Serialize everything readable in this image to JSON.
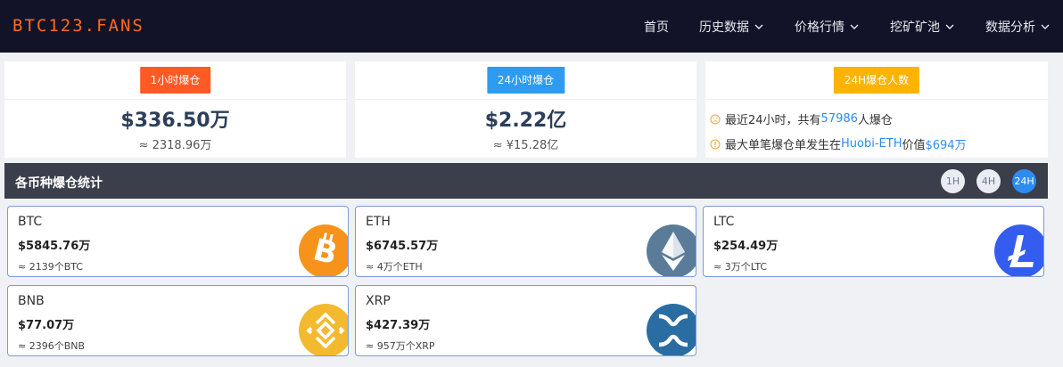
{
  "header": {
    "logo": "BTC123.FANS",
    "nav": [
      {
        "label": "首页",
        "dropdown": false
      },
      {
        "label": "历史数据",
        "dropdown": true
      },
      {
        "label": "价格行情",
        "dropdown": true
      },
      {
        "label": "挖矿矿池",
        "dropdown": true
      },
      {
        "label": "数据分析",
        "dropdown": true
      }
    ]
  },
  "summary": {
    "hour1": {
      "badge": "1小时爆仓",
      "badge_color": "#ff5a23",
      "value": "$336.50万",
      "sub": "≈ 2318.96万"
    },
    "hour24": {
      "badge": "24小时爆仓",
      "badge_color": "#2d9cf0",
      "value": "$2.22亿",
      "sub": "≈ ¥15.28亿"
    },
    "people": {
      "badge": "24H爆仓人数",
      "badge_color": "#fdb300",
      "line1_prefix": "最近24小时，共有",
      "line1_count": "57986",
      "line1_suffix": "人爆仓",
      "line2_prefix": "最大单笔爆仓单发生在",
      "line2_exchange": "Huobi-ETH",
      "line2_mid": "价值",
      "line2_value": "$694万"
    }
  },
  "section": {
    "title": "各币种爆仓统计",
    "timeframes": [
      {
        "label": "1H",
        "active": false
      },
      {
        "label": "4H",
        "active": false
      },
      {
        "label": "24H",
        "active": true
      }
    ]
  },
  "coins": [
    {
      "symbol": "BTC",
      "amount": "$5845.76万",
      "qty": "≈ 2139个BTC",
      "icon": "bitcoin-icon",
      "color": "#f7931a"
    },
    {
      "symbol": "ETH",
      "amount": "$6745.57万",
      "qty": "≈ 4万个ETH",
      "icon": "ethereum-icon",
      "color": "#5b7c99"
    },
    {
      "symbol": "LTC",
      "amount": "$254.49万",
      "qty": "≈ 3万个LTC",
      "icon": "litecoin-icon",
      "color": "#345df0"
    },
    {
      "symbol": "BNB",
      "amount": "$77.07万",
      "qty": "≈ 2396个BNB",
      "icon": "binance-icon",
      "color": "#f3ba2f"
    },
    {
      "symbol": "XRP",
      "amount": "$427.39万",
      "qty": "≈ 957万个XRP",
      "icon": "ripple-icon",
      "color": "#2a6da3"
    }
  ]
}
